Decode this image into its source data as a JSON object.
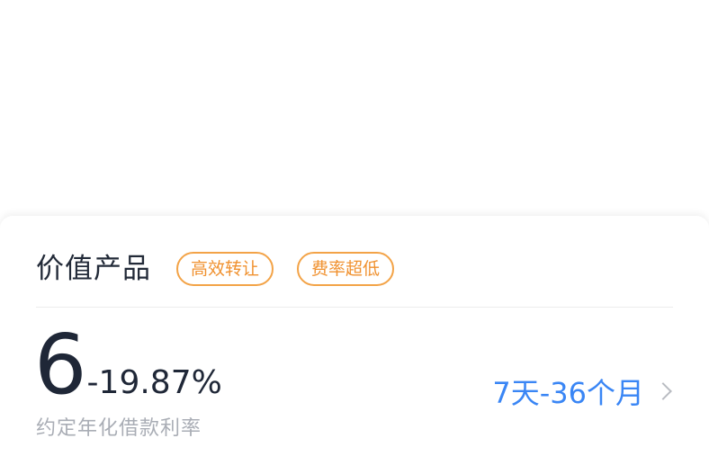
{
  "card": {
    "title": "价值产品",
    "tags": [
      "高效转让",
      "费率超低"
    ],
    "rate_big": "6",
    "rate_rest": "-19.87%",
    "rate_label": "约定年化借款利率",
    "term": "7天-36个月"
  },
  "colors": {
    "tag_orange": "#f0912f",
    "term_blue": "#3a86f5",
    "title_dark": "#222a38",
    "label_gray": "#a9adb5"
  }
}
